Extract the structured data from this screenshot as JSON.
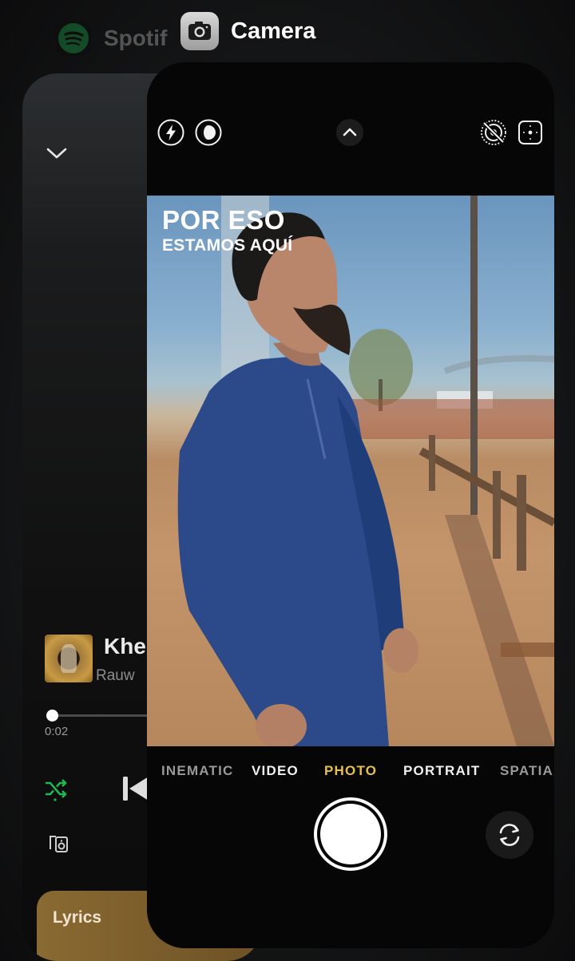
{
  "switcher": {
    "back_app": {
      "name": "Spotify",
      "name_visible": "Spotif"
    },
    "front_app": {
      "name": "Camera"
    }
  },
  "spotify": {
    "track_title": "Khe",
    "track_artist": "Rauw",
    "elapsed_time": "0:02",
    "lyrics_label": "Lyrics",
    "accent_color": "#1DB954"
  },
  "camera": {
    "overlay_line_1": "POR ESO",
    "overlay_line_2": "ESTAMOS AQUÍ",
    "modes": [
      {
        "label": "CINEMATIC",
        "shown": "INEMATIC"
      },
      {
        "label": "VIDEO"
      },
      {
        "label": "PHOTO",
        "active": true
      },
      {
        "label": "PORTRAIT"
      },
      {
        "label": "SPATIAL",
        "shown": "SPATIA"
      }
    ],
    "active_mode_color": "#E7C14E",
    "top_controls": [
      "flash-icon",
      "night-mode-icon",
      "chevron-up-icon",
      "live-photo-off-icon",
      "exposure-icon"
    ]
  }
}
